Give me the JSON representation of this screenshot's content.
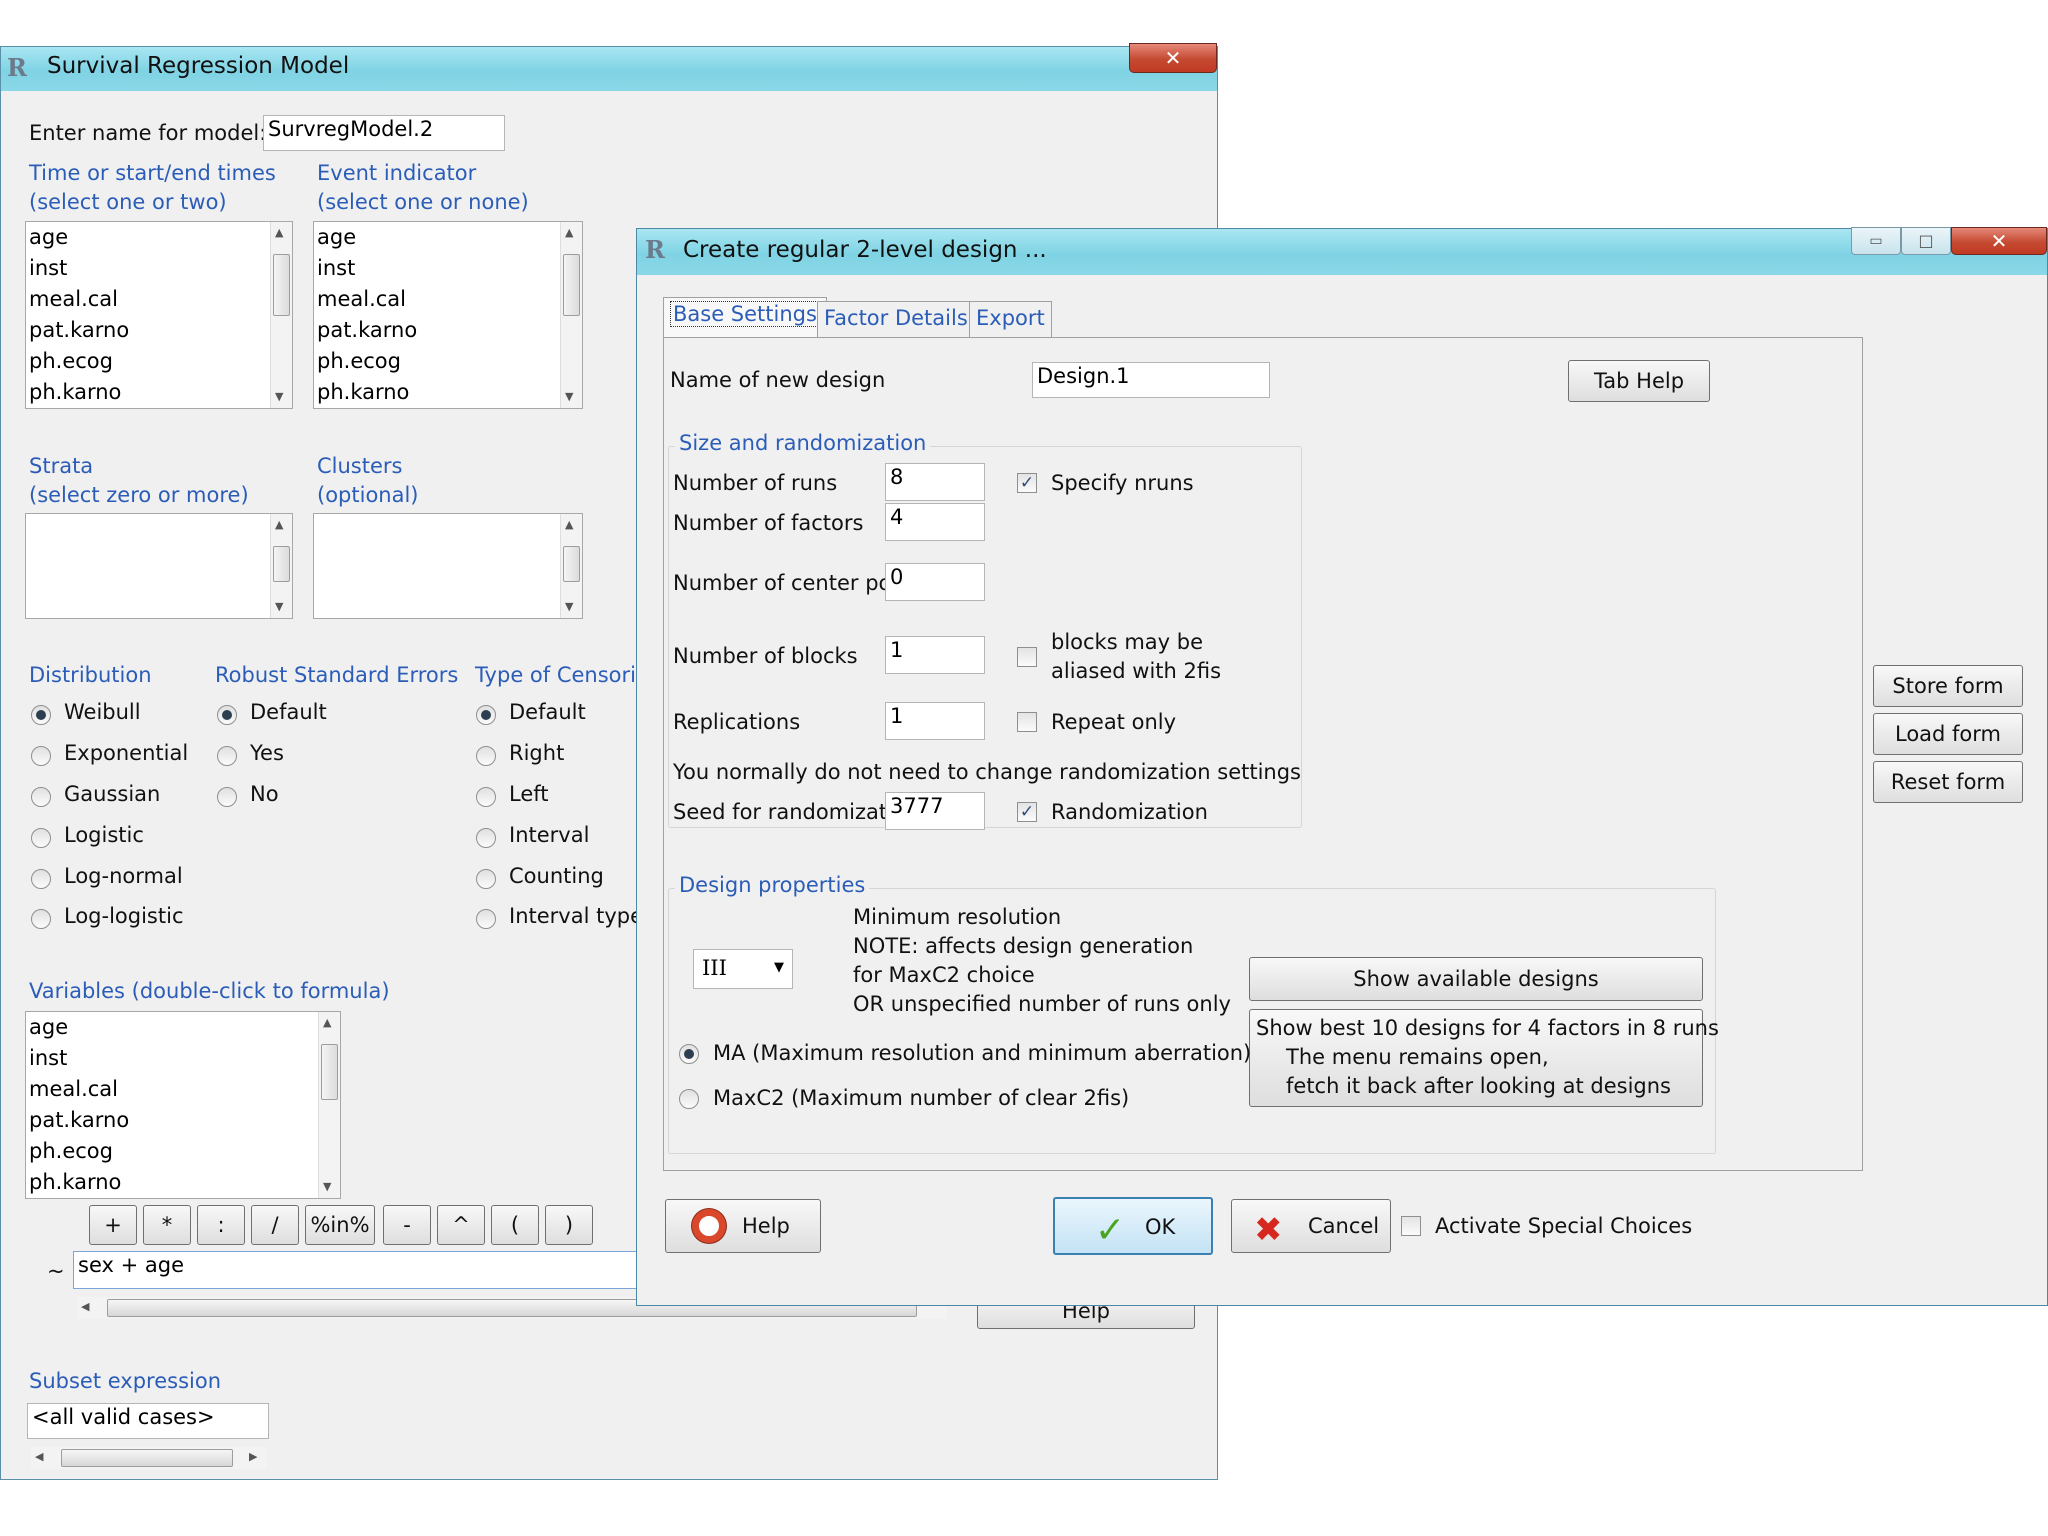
{
  "bg_window": {
    "title": "Survival Regression Model",
    "model_name_label": "Enter name for model:",
    "model_name_value": "SurvregModel.2",
    "time_label_1": "Time or start/end times",
    "time_label_2": "(select one or two)",
    "event_label_1": "Event indicator",
    "event_label_2": "(select one or none)",
    "variables": [
      "age",
      "inst",
      "meal.cal",
      "pat.karno",
      "ph.ecog",
      "ph.karno"
    ],
    "strata_label_1": "Strata",
    "strata_label_2": "(select zero or more)",
    "clusters_label_1": "Clusters",
    "clusters_label_2": "(optional)",
    "distribution_label": "Distribution",
    "distribution_options": [
      "Weibull",
      "Exponential",
      "Gaussian",
      "Logistic",
      "Log-normal",
      "Log-logistic"
    ],
    "robust_label": "Robust Standard Errors",
    "robust_options": [
      "Default",
      "Yes",
      "No"
    ],
    "censoring_label": "Type of Censori",
    "censoring_options": [
      "Default",
      "Right",
      "Left",
      "Interval",
      "Counting",
      "Interval type"
    ],
    "variables_label": "Variables (double-click to formula)",
    "operator_buttons": [
      "+",
      "*",
      ":",
      "/",
      "%in%",
      "-",
      "^",
      "(",
      ")"
    ],
    "tilde": "~",
    "formula_value": "sex + age",
    "help_partial": "Help",
    "subset_label": "Subset expression",
    "subset_value": "<all valid cases>",
    "close_glyph": "✕"
  },
  "dialog": {
    "title": "Create regular 2-level design ...",
    "tabs": [
      "Base Settings",
      "Factor Details",
      "Export"
    ],
    "name_label": "Name of new design",
    "name_value": "Design.1",
    "tab_help": "Tab Help",
    "size_group_title": "Size and randomization",
    "runs_label": "Number of runs",
    "runs_value": "8",
    "specify_nruns": "Specify nruns",
    "factors_label": "Number of factors",
    "factors_value": "4",
    "center_label": "Number of center points",
    "center_value": "0",
    "blocks_label": "Number of blocks",
    "blocks_value": "1",
    "blocks_alias_1": "blocks may be",
    "blocks_alias_2": "aliased with 2fis",
    "replications_label": "Replications",
    "replications_value": "1",
    "repeat_only": "Repeat only",
    "randomization_note": "You normally do not need to change randomization settings",
    "seed_label": "Seed for randomization",
    "seed_value": "3777",
    "randomization": "Randomization",
    "props_group_title": "Design properties",
    "resolution_value": "III",
    "min_res_lines": [
      "Minimum resolution",
      "NOTE: affects design generation",
      "for MaxC2 choice",
      "OR unspecified number of runs only"
    ],
    "show_designs": "Show available designs",
    "show_best_lines": [
      "Show best 10 designs for 4 factors in 8 runs",
      "The menu remains open,",
      "fetch it back after looking at designs"
    ],
    "ma_option": "MA (Maximum resolution and minimum aberration)",
    "maxc2_option": "MaxC2 (Maximum number of clear 2fis)",
    "store_form": "Store form",
    "load_form": "Load form",
    "reset_form": "Reset form",
    "help": "Help",
    "ok": "OK",
    "cancel": "Cancel",
    "special_choices": "Activate Special Choices",
    "close_glyph": "✕",
    "min_glyph": "▭",
    "max_glyph": "□"
  }
}
